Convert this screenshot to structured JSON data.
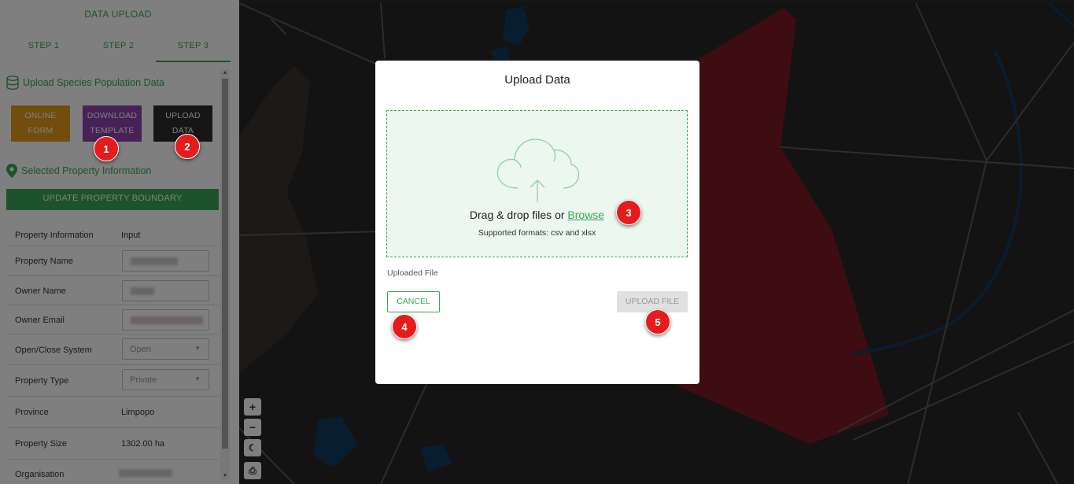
{
  "sidebar": {
    "title": "DATA UPLOAD",
    "steps": [
      "STEP 1",
      "STEP 2",
      "STEP 3"
    ],
    "section_upload": "Upload Species Population Data",
    "buttons": {
      "online_form": [
        "ONLINE",
        "FORM"
      ],
      "download_template": [
        "DOWNLOAD",
        "TEMPLATE"
      ],
      "upload_data": [
        "UPLOAD",
        "DATA"
      ]
    },
    "section_property": "Selected Property Information",
    "update_boundary": "UPDATE PROPERTY BOUNDARY",
    "table_headers": [
      "Property Information",
      "Input"
    ],
    "rows": {
      "property_name": "Property Name",
      "owner_name": "Owner Name",
      "owner_email": "Owner Email",
      "open_close": "Open/Close System",
      "open_close_value": "Open",
      "property_type": "Property Type",
      "property_type_value": "Private",
      "province": "Province",
      "province_value": "Limpopo",
      "property_size": "Property Size",
      "property_size_value": "1302.00 ha",
      "organisation": "Organisation"
    },
    "accent_color": "#3aa655"
  },
  "modal": {
    "title": "Upload Data",
    "drop_text": "Drag & drop files or ",
    "browse": "Browse",
    "formats": "Supported formats: csv and xlsx",
    "uploaded_file": "Uploaded File",
    "cancel": "CANCEL",
    "upload_file": "UPLOAD FILE"
  },
  "map_controls": [
    "+",
    "−"
  ],
  "badges": [
    "1",
    "2",
    "3",
    "4",
    "5"
  ]
}
